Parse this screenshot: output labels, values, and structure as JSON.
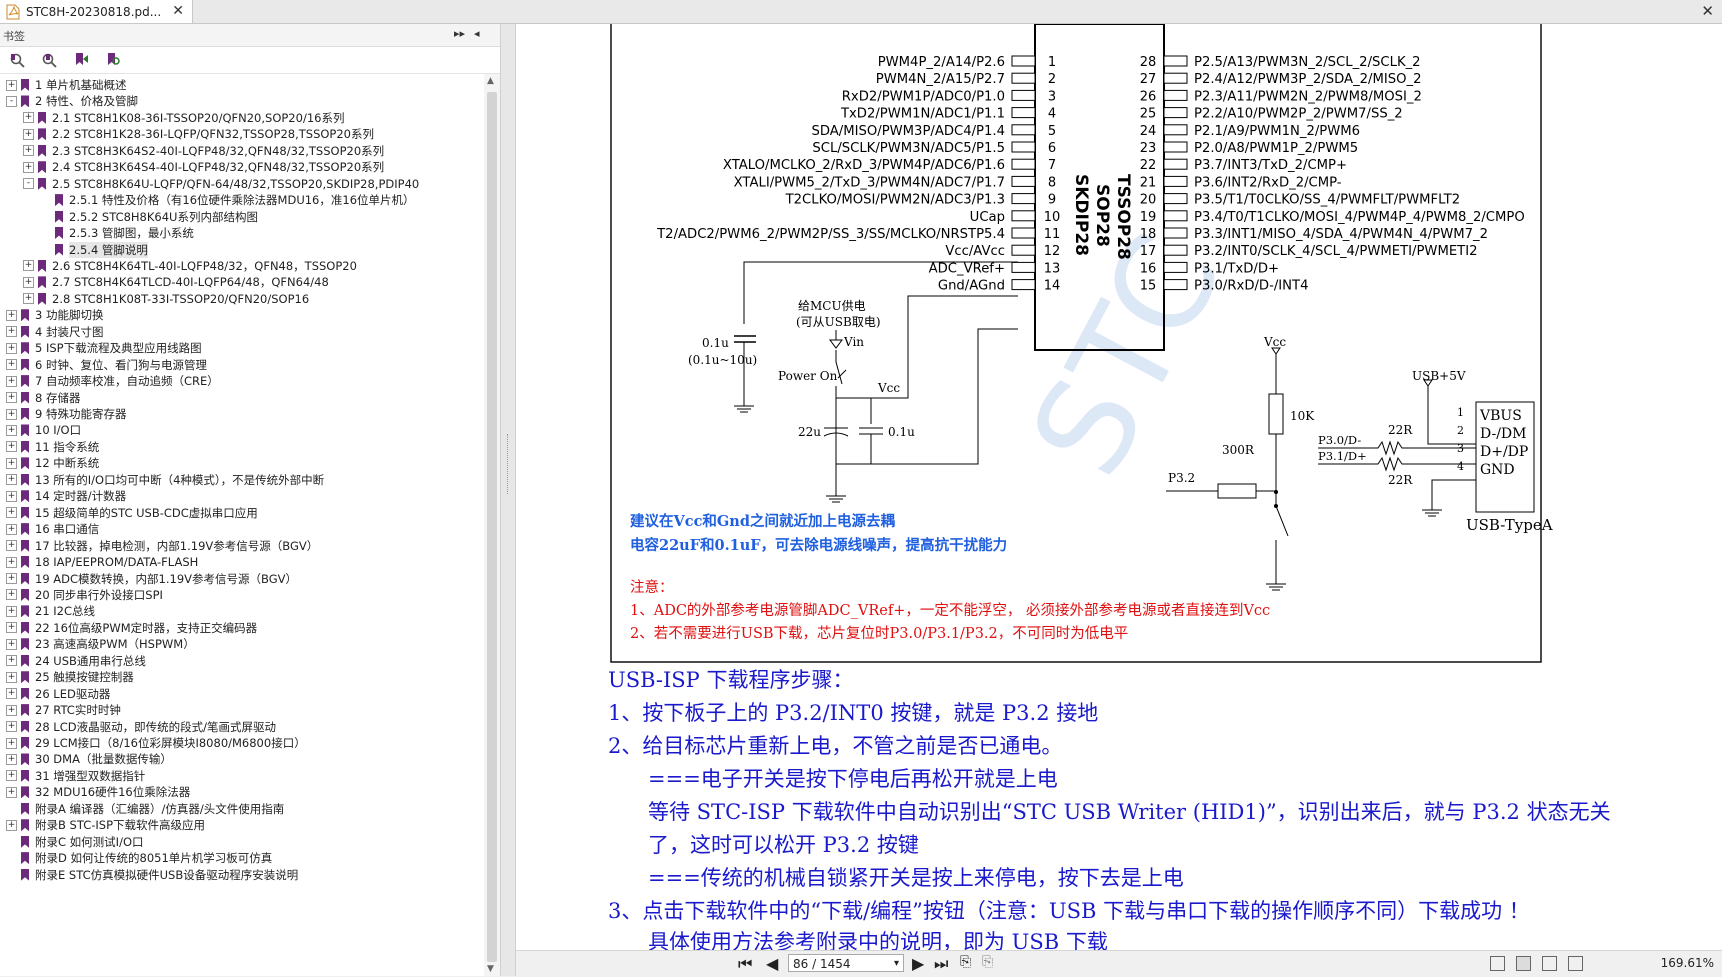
{
  "tab": {
    "title": "STC8H-20230818.pd..."
  },
  "sidebar": {
    "header": "书签",
    "items": [
      {
        "label": "1 单片机基础概述",
        "level": 0,
        "expander": "+"
      },
      {
        "label": "2  特性、价格及管脚",
        "level": 0,
        "expander": "-"
      },
      {
        "label": "2.1 STC8H1K08-36I-TSSOP20/QFN20,SOP20/16系列",
        "level": 1,
        "expander": "+"
      },
      {
        "label": "2.2  STC8H1K28-36I-LQFP/QFN32,TSSOP28,TSSOP20系列",
        "level": 1,
        "expander": "+"
      },
      {
        "label": "2.3  STC8H3K64S2-40I-LQFP48/32,QFN48/32,TSSOP20系列",
        "level": 1,
        "expander": "+"
      },
      {
        "label": "2.4  STC8H3K64S4-40I-LQFP48/32,QFN48/32,TSSOP20系列",
        "level": 1,
        "expander": "+"
      },
      {
        "label": "2.5  STC8H8K64U-LQFP/QFN-64/48/32,TSSOP20,SKDIP28,PDIP40",
        "level": 1,
        "expander": "-"
      },
      {
        "label": "2.5.1 特性及价格（有16位硬件乘除法器MDU16，准16位单片机）",
        "level": 2,
        "expander": ""
      },
      {
        "label": "2.5.2  STC8H8K64U系列内部结构图",
        "level": 2,
        "expander": ""
      },
      {
        "label": "2.5.3  管脚图，最小系统",
        "level": 2,
        "expander": ""
      },
      {
        "label": "2.5.4  管脚说明",
        "level": 2,
        "expander": "",
        "selected": true
      },
      {
        "label": "2.6  STC8H4K64TL-40I-LQFP48/32，QFN48，TSSOP20",
        "level": 1,
        "expander": "+"
      },
      {
        "label": "2.7  STC8H4K64TLCD-40I-LQFP64/48，QFN64/48",
        "level": 1,
        "expander": "+"
      },
      {
        "label": "2.8  STC8H1K08T-33I-TSSOP20/QFN20/SOP16",
        "level": 1,
        "expander": "+"
      },
      {
        "label": "3  功能脚切换",
        "level": 0,
        "expander": "+"
      },
      {
        "label": "4  封装尺寸图",
        "level": 0,
        "expander": "+"
      },
      {
        "label": "5  ISP下载流程及典型应用线路图",
        "level": 0,
        "expander": "+"
      },
      {
        "label": "6  时钟、复位、看门狗与电源管理",
        "level": 0,
        "expander": "+"
      },
      {
        "label": "7  自动频率校准，自动追频（CRE）",
        "level": 0,
        "expander": "+"
      },
      {
        "label": "8  存储器",
        "level": 0,
        "expander": "+"
      },
      {
        "label": "9  特殊功能寄存器",
        "level": 0,
        "expander": "+"
      },
      {
        "label": "10  I/O口",
        "level": 0,
        "expander": "+"
      },
      {
        "label": "11  指令系统",
        "level": 0,
        "expander": "+"
      },
      {
        "label": "12  中断系统",
        "level": 0,
        "expander": "+"
      },
      {
        "label": "13  所有的I/O口均可中断（4种模式），不是传统外部中断",
        "level": 0,
        "expander": "+"
      },
      {
        "label": "14  定时器/计数器",
        "level": 0,
        "expander": "+"
      },
      {
        "label": "15  超级简单的STC USB-CDC虚拟串口应用",
        "level": 0,
        "expander": "+"
      },
      {
        "label": "16  串口通信",
        "level": 0,
        "expander": "+"
      },
      {
        "label": "17  比较器，掉电检测，内部1.19V参考信号源（BGV）",
        "level": 0,
        "expander": "+"
      },
      {
        "label": "18  IAP/EEPROM/DATA-FLASH",
        "level": 0,
        "expander": "+"
      },
      {
        "label": "19  ADC模数转换，内部1.19V参考信号源（BGV）",
        "level": 0,
        "expander": "+"
      },
      {
        "label": "20  同步串行外设接口SPI",
        "level": 0,
        "expander": "+"
      },
      {
        "label": "21  I2C总线",
        "level": 0,
        "expander": "+"
      },
      {
        "label": "22  16位高级PWM定时器，支持正交编码器",
        "level": 0,
        "expander": "+"
      },
      {
        "label": "23  高速高级PWM（HSPWM）",
        "level": 0,
        "expander": "+"
      },
      {
        "label": "24  USB通用串行总线",
        "level": 0,
        "expander": "+"
      },
      {
        "label": "25  触摸按键控制器",
        "level": 0,
        "expander": "+"
      },
      {
        "label": "26  LED驱动器",
        "level": 0,
        "expander": "+"
      },
      {
        "label": "27  RTC实时时钟",
        "level": 0,
        "expander": "+"
      },
      {
        "label": "28  LCD液晶驱动，即传统的段式/笔画式屏驱动",
        "level": 0,
        "expander": "+"
      },
      {
        "label": "29  LCM接口（8/16位彩屏模块I8080/M6800接口）",
        "level": 0,
        "expander": "+"
      },
      {
        "label": "30  DMA（批量数据传输）",
        "level": 0,
        "expander": "+"
      },
      {
        "label": "31  增强型双数据指针",
        "level": 0,
        "expander": "+"
      },
      {
        "label": "32  MDU16硬件16位乘除法器",
        "level": 0,
        "expander": "+"
      },
      {
        "label": "附录A  编译器（汇编器）/仿真器/头文件使用指南",
        "level": 0,
        "expander": ""
      },
      {
        "label": "附录B  STC-ISP下载软件高级应用",
        "level": 0,
        "expander": "+"
      },
      {
        "label": "附录C  如何测试I/O口",
        "level": 0,
        "expander": ""
      },
      {
        "label": "附录D  如何让传统的8051单片机学习板可仿真",
        "level": 0,
        "expander": ""
      },
      {
        "label": "附录E  STC仿真模拟硬件USB设备驱动程序安装说明",
        "level": 0,
        "expander": ""
      }
    ]
  },
  "chip": {
    "names": [
      "TSSOP28",
      "SOP28",
      "SKDIP28"
    ],
    "left_pins": [
      {
        "num": "1",
        "label": "PWM4P_2/A14/P2.6"
      },
      {
        "num": "2",
        "label": "PWM4N_2/A15/P2.7"
      },
      {
        "num": "3",
        "label": "RxD2/PWM1P/ADC0/P1.0"
      },
      {
        "num": "4",
        "label": "TxD2/PWM1N/ADC1/P1.1"
      },
      {
        "num": "5",
        "label": "SDA/MISO/PWM3P/ADC4/P1.4"
      },
      {
        "num": "6",
        "label": "SCL/SCLK/PWM3N/ADC5/P1.5"
      },
      {
        "num": "7",
        "label": "XTALO/MCLKO_2/RxD_3/PWM4P/ADC6/P1.6"
      },
      {
        "num": "8",
        "label": "XTALI/PWM5_2/TxD_3/PWM4N/ADC7/P1.7"
      },
      {
        "num": "9",
        "label": "T2CLKO/MOSI/PWM2N/ADC3/P1.3"
      },
      {
        "num": "10",
        "label": "UCap"
      },
      {
        "num": "11",
        "label": "T2/ADC2/PWM6_2/PWM2P/SS_3/SS/MCLKO/NRSTP5.4"
      },
      {
        "num": "12",
        "label": "Vcc/AVcc"
      },
      {
        "num": "13",
        "label": "ADC_VRef+"
      },
      {
        "num": "14",
        "label": "Gnd/AGnd"
      }
    ],
    "right_pins": [
      {
        "num": "28",
        "label": "P2.5/A13/PWM3N_2/SCL_2/SCLK_2"
      },
      {
        "num": "27",
        "label": "P2.4/A12/PWM3P_2/SDA_2/MISO_2"
      },
      {
        "num": "26",
        "label": "P2.3/A11/PWM2N_2/PWM8/MOSI_2"
      },
      {
        "num": "25",
        "label": "P2.2/A10/PWM2P_2/PWM7/SS_2"
      },
      {
        "num": "24",
        "label": "P2.1/A9/PWM1N_2/PWM6"
      },
      {
        "num": "23",
        "label": "P2.0/A8/PWM1P_2/PWM5"
      },
      {
        "num": "22",
        "label": "P3.7/INT3/TxD_2/CMP+"
      },
      {
        "num": "21",
        "label": "P3.6/INT2/RxD_2/CMP-"
      },
      {
        "num": "20",
        "label": "P3.5/T1/T0CLKO/SS_4/PWMFLT/PWMFLT2"
      },
      {
        "num": "19",
        "label": "P3.4/T0/T1CLKO/MOSI_4/PWM4P_4/PWM8_2/CMPO"
      },
      {
        "num": "18",
        "label": "P3.3/INT1/MISO_4/SDA_4/PWM4N_4/PWM7_2"
      },
      {
        "num": "17",
        "label": "P3.2/INT0/SCLK_4/SCL_4/PWMETI/PWMETI2"
      },
      {
        "num": "16",
        "label": "P3.1/TxD/D+"
      },
      {
        "num": "15",
        "label": "P3.0/RxD/D-/INT4"
      }
    ]
  },
  "schematic": {
    "ucap_cap_value": "0.1u",
    "ucap_cap_range": "(0.1u~10u)",
    "supply_note_line1": "给MCU供电",
    "supply_note_line2": "(可从USB取电)",
    "vin_label": "Vin",
    "power_on_label": "Power On",
    "vcc_label": "Vcc",
    "cap_22u": "22u",
    "cap_01u": "0.1u",
    "decouple_note_1": "建议在Vcc和Gnd之间就近加上电源去耦",
    "decouple_note_2": "电容22uF和0.1uF，可去除电源线噪声，提高抗干扰能力",
    "notice_title": "注意：",
    "notice_1": "1、ADC的外部参考电源管脚ADC_VRef+，一定不能浮空，  必须接外部参考电源或者直接连到Vcc",
    "notice_2": "2、若不需要进行USB下载，芯片复位时P3.0/P3.1/P3.2，不可同时为低电平",
    "btn_vcc_label": "Vcc",
    "r10k": "10K",
    "r300": "300R",
    "p32_label": "P3.2",
    "usb5v": "USB+5V",
    "p30_label": "P3.0/D-",
    "p31_label": "P3.1/D+",
    "r22_top": "22R",
    "r22_bot": "22R",
    "usb_pins": [
      {
        "num": "1",
        "name": "VBUS"
      },
      {
        "num": "2",
        "name": "D-/DM"
      },
      {
        "num": "3",
        "name": "D+/DP"
      },
      {
        "num": "4",
        "name": "GND"
      }
    ],
    "usb_conn_label": "USB-TypeA"
  },
  "steps": {
    "title": "USB-ISP 下载程序步骤：",
    "s1": "1、按下板子上的 P3.2/INT0 按键，就是 P3.2 接地",
    "s2": "2、给目标芯片重新上电，不管之前是否已通电。",
    "s2a": "===电子开关是按下停电后再松开就是上电",
    "s2b": "等待 STC-ISP 下载软件中自动识别出“STC USB Writer (HID1)”，识别出来后，就与 P3.2 状态无关",
    "s2c": "了，这时可以松开 P3.2 按键",
    "s2d": "===传统的机械自锁紧开关是按上来停电，按下去是上电",
    "s3": "3、点击下载软件中的“下载/编程”按钮（注意：USB 下载与串口下载的操作顺序不同）下载成功 ！",
    "s4": "具体使用方法参考附录中的说明，即为 USB 下载"
  },
  "navbar": {
    "page": "86 / 1454",
    "zoom": "169.61%"
  },
  "colors": {
    "bookmark": "#6b2a7a",
    "blue_text": "#1a1acc",
    "red_text": "#e01010",
    "note_blue": "#1f5fe0"
  }
}
